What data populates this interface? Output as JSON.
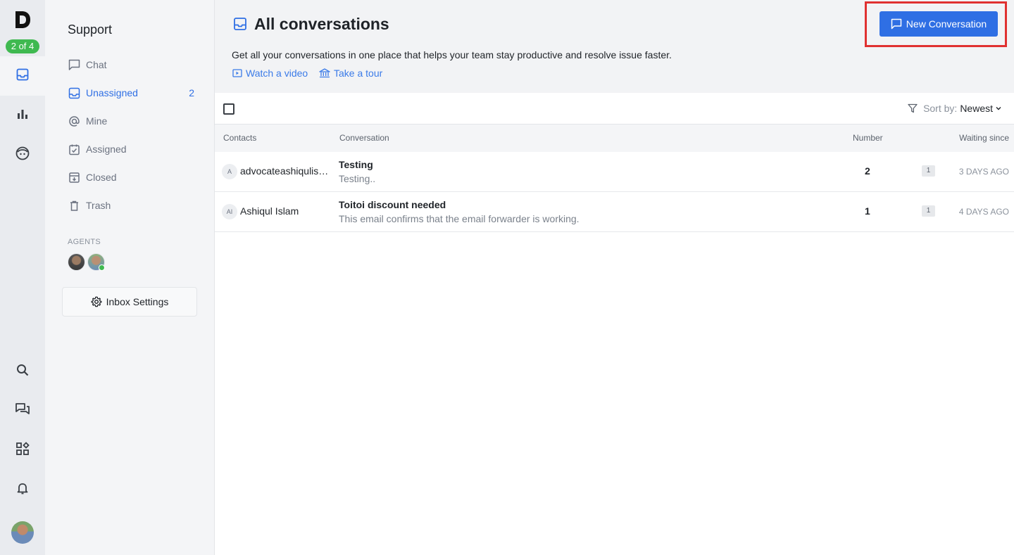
{
  "rail": {
    "step_badge": "2 of 4",
    "items": [
      {
        "name": "inbox-icon",
        "active": true
      },
      {
        "name": "reports-icon",
        "active": false
      },
      {
        "name": "contacts-icon",
        "active": false
      },
      {
        "name": "search-icon",
        "active": false
      },
      {
        "name": "chat-bubbles-icon",
        "active": false
      },
      {
        "name": "apps-icon",
        "active": false
      },
      {
        "name": "bell-icon",
        "active": false
      }
    ]
  },
  "sidebar": {
    "title": "Support",
    "items": [
      {
        "label": "Chat",
        "icon": "chat-icon",
        "count": ""
      },
      {
        "label": "Unassigned",
        "icon": "inbox-icon",
        "count": "2",
        "active": true
      },
      {
        "label": "Mine",
        "icon": "at-icon",
        "count": ""
      },
      {
        "label": "Assigned",
        "icon": "assigned-icon",
        "count": ""
      },
      {
        "label": "Closed",
        "icon": "archive-icon",
        "count": ""
      },
      {
        "label": "Trash",
        "icon": "trash-icon",
        "count": ""
      }
    ],
    "agents_label": "AGENTS",
    "inbox_settings_label": "Inbox Settings"
  },
  "main": {
    "title": "All conversations",
    "new_conversation_label": "New Conversation",
    "subtitle": "Get all your conversations in one place that helps your team stay productive and resolve issue faster.",
    "watch_video_label": "Watch a video",
    "take_tour_label": "Take a tour",
    "sort_label": "Sort by:",
    "sort_value": "Newest",
    "columns": {
      "contacts": "Contacts",
      "conversation": "Conversation",
      "number": "Number",
      "waiting": "Waiting since"
    },
    "rows": [
      {
        "initials": "A",
        "contact": "advocateashiqulislam",
        "subject": "Testing",
        "preview": "Testing..",
        "number": "2",
        "badge": "1",
        "waiting": "3 DAYS AGO"
      },
      {
        "initials": "AI",
        "contact": "Ashiqul Islam",
        "subject": "Toitoi discount needed",
        "preview": "This email confirms that the email forwarder is working.",
        "number": "1",
        "badge": "1",
        "waiting": "4 DAYS AGO"
      }
    ]
  },
  "colors": {
    "accent": "#2f6fe4",
    "link": "#3b7be8",
    "badge_green": "#3fb950",
    "highlight_red": "#e03131"
  }
}
